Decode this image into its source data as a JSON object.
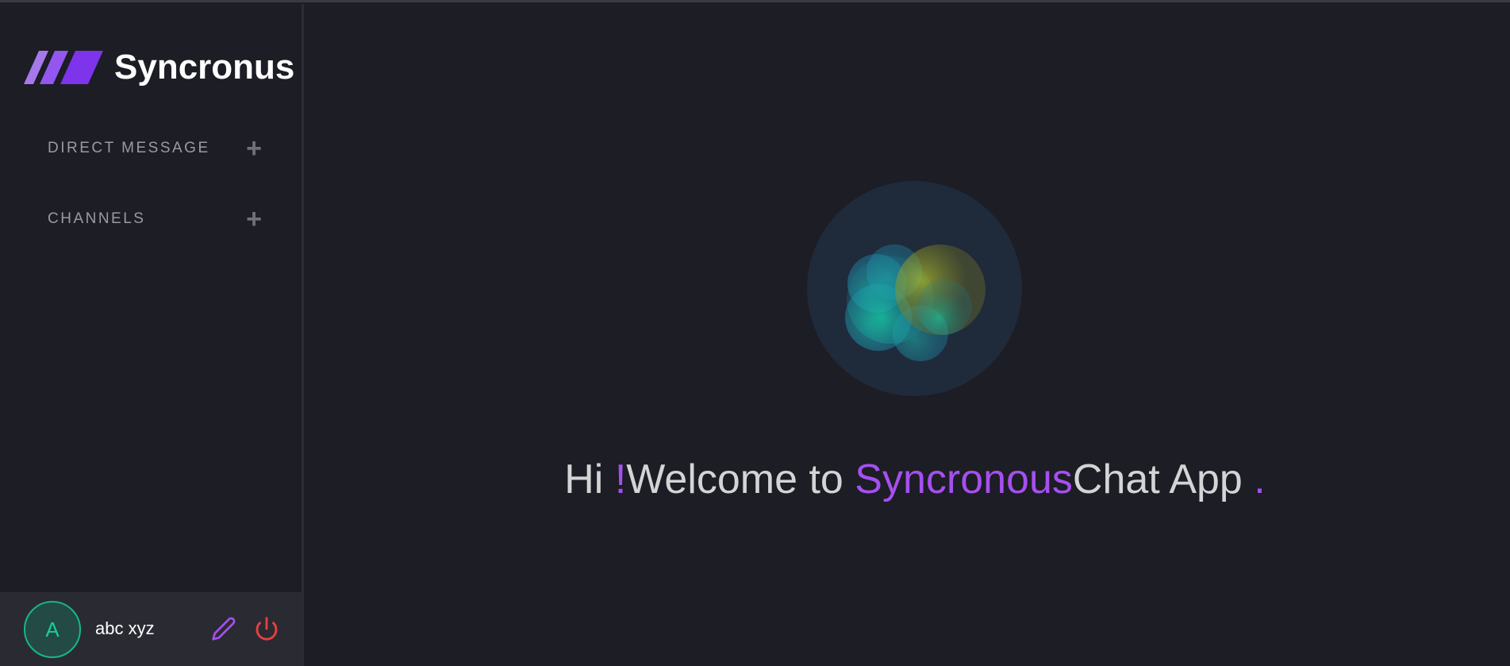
{
  "app": {
    "name": "Syncronus"
  },
  "sidebar": {
    "sections": [
      {
        "label": "DIRECT MESSAGE",
        "action_icon": "plus-icon"
      },
      {
        "label": "CHANNELS",
        "action_icon": "plus-icon"
      }
    ]
  },
  "user": {
    "avatar_initial": "A",
    "name": "abc xyz",
    "edit_icon": "pencil-icon",
    "logout_icon": "power-icon"
  },
  "welcome": {
    "hi": "Hi ",
    "exclaim": "!",
    "welcome_to": "Welcome to ",
    "brand": "Syncronous",
    "rest": "Chat App ",
    "dot": "."
  },
  "colors": {
    "accent": "#a64fef",
    "avatar": "#18cf96",
    "logout": "#e5413e",
    "background": "#1c1d25"
  }
}
